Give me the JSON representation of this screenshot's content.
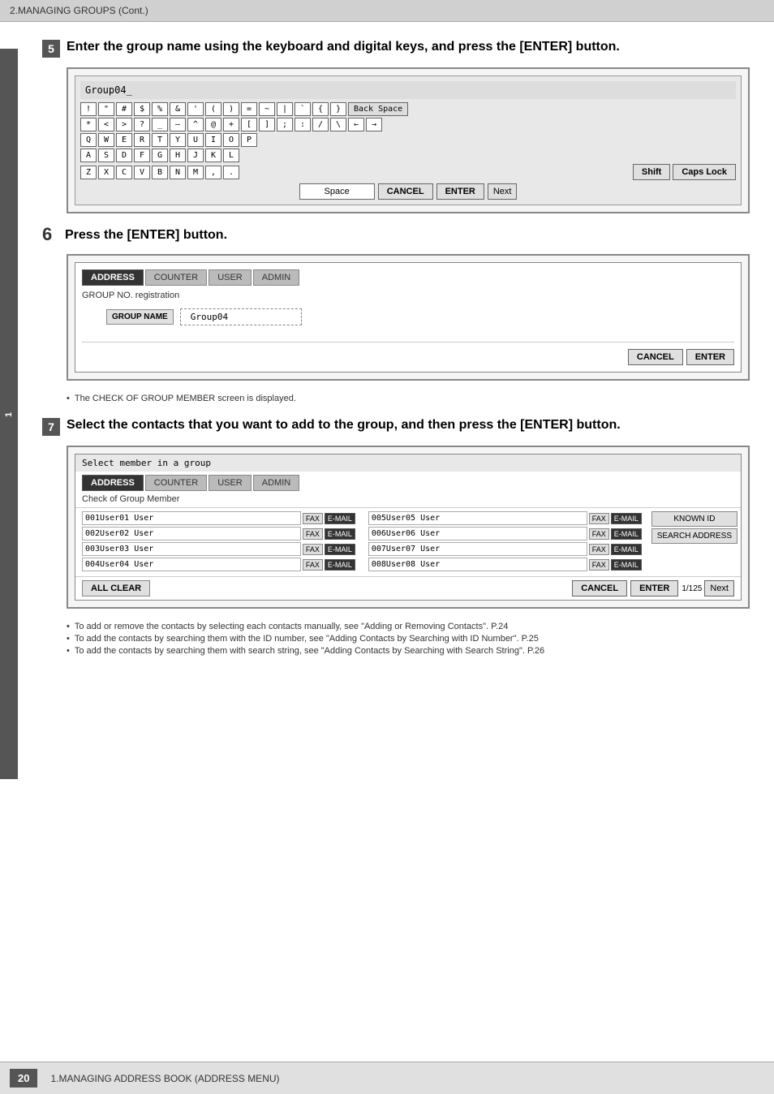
{
  "header": {
    "title": "2.MANAGING GROUPS (Cont.)"
  },
  "left_tab": {
    "label": "1"
  },
  "steps": [
    {
      "number": "5",
      "text": "Enter the group name using the keyboard and digital keys, and press the [ENTER] button.",
      "screen": {
        "type": "keyboard",
        "input_value": "Group04_",
        "keyboard_rows": [
          [
            "!",
            "\"",
            "#",
            "$",
            "%",
            "&",
            "'",
            "(",
            ")",
            "=",
            "~",
            "|",
            "`",
            "{",
            "}"
          ],
          [
            "*",
            "<",
            ">",
            "?",
            "_",
            "—",
            "^",
            "@",
            "+",
            "[",
            "]",
            ";",
            ":",
            "/",
            "\\"
          ],
          [
            "Q",
            "W",
            "E",
            "R",
            "T",
            "Y",
            "U",
            "I",
            "O",
            "P"
          ],
          [
            "A",
            "S",
            "D",
            "F",
            "G",
            "H",
            "J",
            "K",
            "L"
          ],
          [
            "Z",
            "X",
            "C",
            "V",
            "B",
            "N",
            "M",
            ",",
            "."
          ]
        ],
        "special_keys": {
          "backspace": "Back Space",
          "shift": "Shift",
          "caps_lock": "Caps Lock",
          "space": "Space",
          "cancel": "CANCEL",
          "enter": "ENTER",
          "next": "Next"
        }
      }
    },
    {
      "number": "6",
      "text": "Press the [ENTER] button.",
      "screen": {
        "type": "registration",
        "tabs": [
          "ADDRESS",
          "COUNTER",
          "USER",
          "ADMIN"
        ],
        "active_tab": "ADDRESS",
        "title": "GROUP NO. registration",
        "group_name_label": "GROUP NAME",
        "group_name_value": "Group04",
        "buttons": {
          "cancel": "CANCEL",
          "enter": "ENTER"
        }
      },
      "note": "The CHECK OF GROUP MEMBER screen is displayed."
    },
    {
      "number": "7",
      "text": "Select the contacts that you want to add to the group, and then press the [ENTER] button.",
      "screen": {
        "type": "member_select",
        "title_bar": "Select member in a group",
        "tabs": [
          "ADDRESS",
          "COUNTER",
          "USER",
          "ADMIN"
        ],
        "active_tab": "ADDRESS",
        "check_title": "Check of Group Member",
        "members_left": [
          {
            "name": "001User01 User",
            "fax": true,
            "email": true
          },
          {
            "name": "002User02 User",
            "fax": true,
            "email": true
          },
          {
            "name": "003User03 User",
            "fax": true,
            "email": true
          },
          {
            "name": "004User04 User",
            "fax": true,
            "email": true
          }
        ],
        "members_right": [
          {
            "name": "005User05 User",
            "fax": true,
            "email": true
          },
          {
            "name": "006User06 User",
            "fax": true,
            "email": true
          },
          {
            "name": "007User07 User",
            "fax": true,
            "email": true
          },
          {
            "name": "008User08 User",
            "fax": true,
            "email": true
          }
        ],
        "right_buttons": {
          "known_id": "KNOWN ID",
          "search_address": "SEARCH ADDRESS"
        },
        "footer": {
          "all_clear": "ALL CLEAR",
          "cancel": "CANCEL",
          "enter": "ENTER",
          "page_info": "1/125",
          "next": "Next"
        }
      },
      "notes": [
        "To add or remove the contacts by selecting each contacts manually, see \"Adding or Removing Contacts\".  P.24",
        "To add the contacts by searching them with the ID number, see \"Adding Contacts by Searching with ID Number\".  P.25",
        "To add the contacts by searching them with search string, see \"Adding Contacts by Searching with Search String\".  P.26"
      ]
    }
  ],
  "footer": {
    "text": "1.MANAGING ADDRESS BOOK (ADDRESS MENU)",
    "page": "20"
  }
}
